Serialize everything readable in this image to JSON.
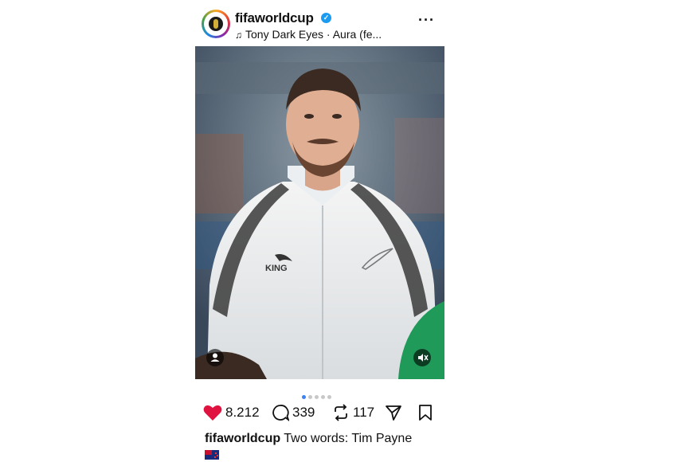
{
  "post": {
    "username": "fifaworldcup",
    "verified_icon": "verified-check-icon",
    "music": {
      "icon": "music-note-icon",
      "text": "Tony Dark Eyes · Aura (fe..."
    },
    "more_icon": "more-dots-icon",
    "media": {
      "mute_icon": "speaker-muted-icon",
      "user_tag_icon": "person-tag-icon",
      "pager_count": 5,
      "pager_active": 0
    },
    "actions": {
      "likes": "8.212",
      "comments": "339",
      "reposts": "117",
      "share_icon": "send-icon",
      "save_icon": "bookmark-icon"
    },
    "caption": {
      "username": "fifaworldcup",
      "text": " Two words: Tim Payne"
    },
    "flag_icon": "new-zealand-flag-icon"
  },
  "colors": {
    "like_red": "#e0123f",
    "verified_blue": "#1d9bf0",
    "pager_active": "#3b82f6"
  }
}
